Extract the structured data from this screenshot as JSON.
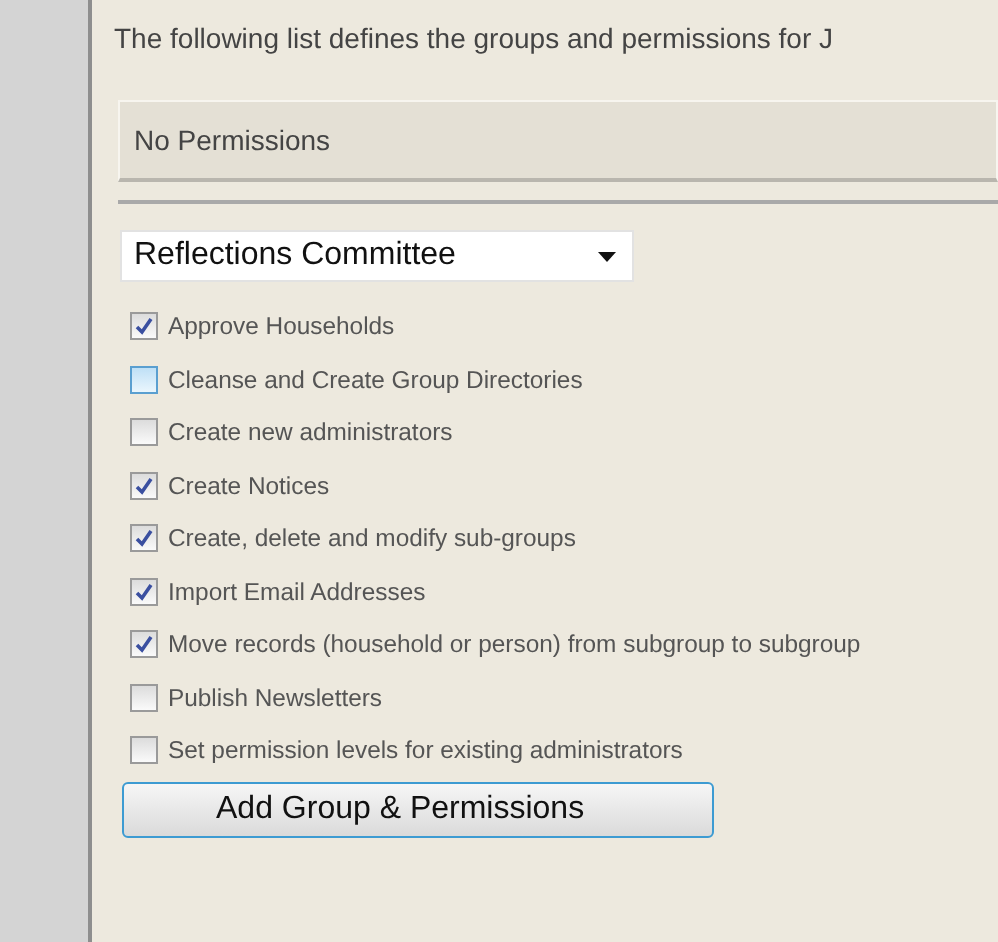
{
  "intro": "The following list defines the groups and permissions for J",
  "panel": {
    "text": "No Permissions"
  },
  "group_select": {
    "value": "Reflections Committee"
  },
  "permissions": [
    {
      "label": "Approve Households",
      "checked": true,
      "hovered": false
    },
    {
      "label": "Cleanse and Create Group Directories",
      "checked": false,
      "hovered": true
    },
    {
      "label": "Create new administrators",
      "checked": false,
      "hovered": false
    },
    {
      "label": "Create Notices",
      "checked": true,
      "hovered": false
    },
    {
      "label": "Create, delete and modify sub-groups",
      "checked": true,
      "hovered": false
    },
    {
      "label": "Import Email Addresses",
      "checked": true,
      "hovered": false
    },
    {
      "label": "Move records (household or person) from subgroup to subgroup",
      "checked": true,
      "hovered": false
    },
    {
      "label": "Publish Newsletters",
      "checked": false,
      "hovered": false
    },
    {
      "label": "Set permission levels for existing administrators",
      "checked": false,
      "hovered": false
    }
  ],
  "buttons": [
    "Add Group & Permissions"
  ]
}
